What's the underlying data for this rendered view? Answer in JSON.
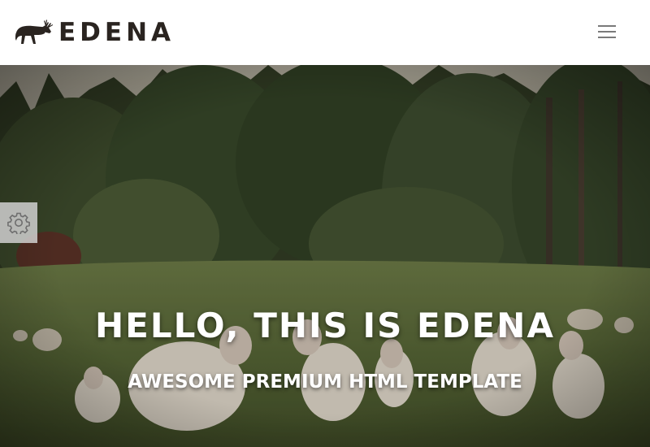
{
  "brand": {
    "name": "EDENA",
    "logo_icon": "deer-icon",
    "color": "#2a2420"
  },
  "navbar": {
    "menu_icon": "hamburger-menu-icon",
    "menu_color": "#7a7a7a",
    "background": "#ffffff"
  },
  "hero": {
    "title": "HELLO, THIS IS EDENA",
    "subtitle": "AWESOME PREMIUM HTML TEMPLATE",
    "image": "sheep-in-meadow-photo",
    "text_color": "#ffffff"
  },
  "settings_panel": {
    "icon": "gear-icon",
    "background": "#d0d0d0",
    "icon_color": "#6e6e6e"
  }
}
